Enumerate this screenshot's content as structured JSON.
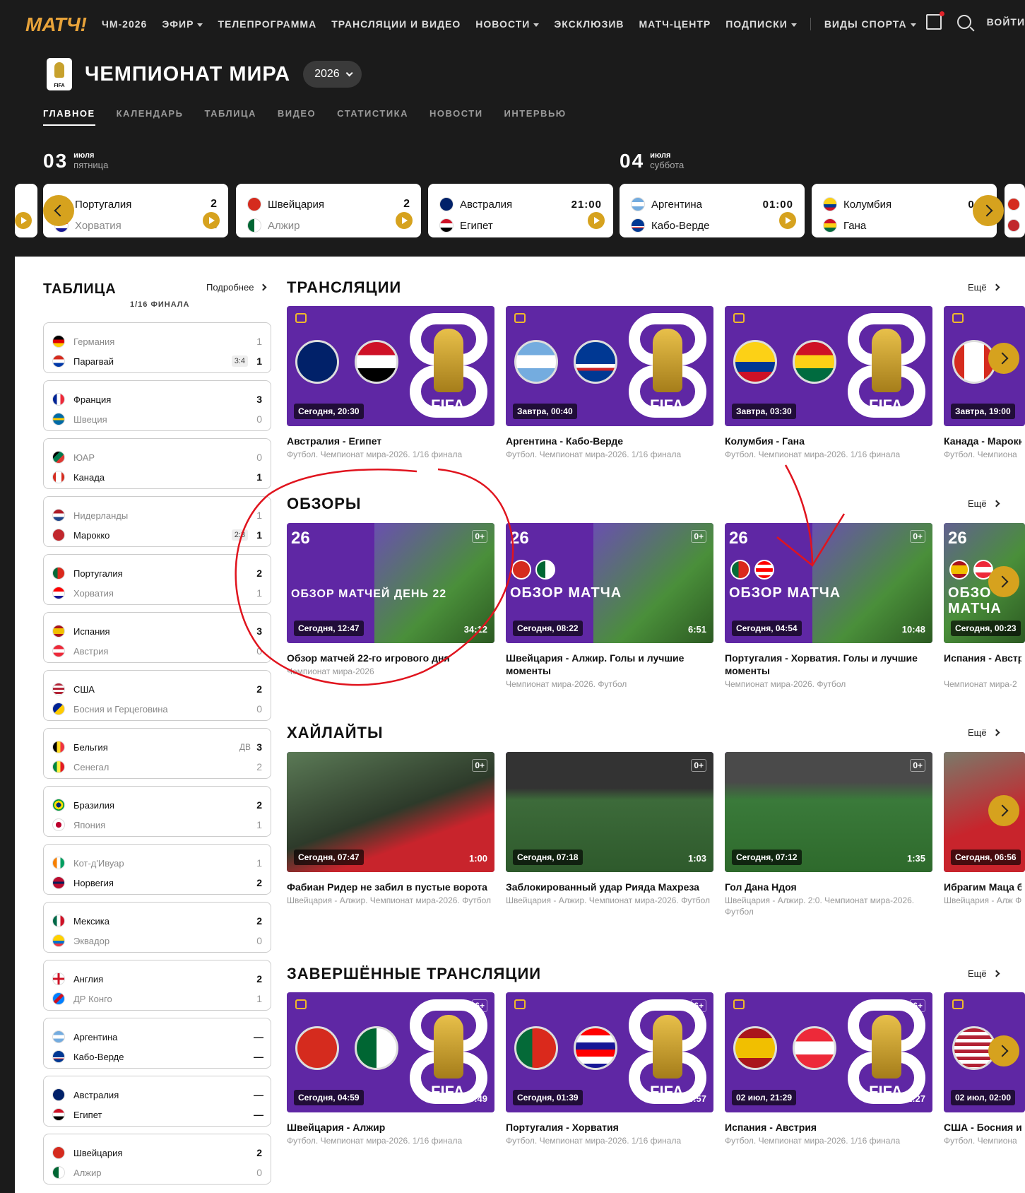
{
  "nav": {
    "items": [
      "ЧМ-2026",
      "ЭФИР",
      "ТЕЛЕПРОГРАММА",
      "ТРАНСЛЯЦИИ И ВИДЕО",
      "НОВОСТИ",
      "ЭКСКЛЮЗИВ",
      "МАТЧ-ЦЕНТР",
      "ПОДПИСКИ",
      "ВИДЫ СПОРТА"
    ],
    "login": "ВОЙТИ",
    "logo": "МАТЧ!"
  },
  "champ": {
    "title": "ЧЕМПИОНАТ МИРА",
    "year": "2026",
    "logo_text": "FIFA"
  },
  "subnav": [
    "ГЛАВНОЕ",
    "КАЛЕНДАРЬ",
    "ТАБЛИЦА",
    "ВИДЕО",
    "СТАТИСТИКА",
    "НОВОСТИ",
    "ИНТЕРВЬЮ"
  ],
  "days": [
    {
      "num": "03",
      "month": "июля",
      "weekday": "пятница"
    },
    {
      "num": "04",
      "month": "июля",
      "weekday": "суббота"
    }
  ],
  "matches": [
    {
      "t1": "Португалия",
      "t2": "Хорватия",
      "s1": "2",
      "s2": "1"
    },
    {
      "t1": "Швейцария",
      "t2": "Алжир",
      "s1": "2",
      "s2": "0"
    },
    {
      "t1": "Австралия",
      "t2": "Египет",
      "time": "21:00"
    },
    {
      "t1": "Аргентина",
      "t2": "Кабо-Верде",
      "time": "01:00"
    },
    {
      "t1": "Колумбия",
      "t2": "Гана",
      "time": "04:"
    }
  ],
  "table": {
    "title": "ТАБЛИЦА",
    "more": "Подробнее",
    "stage": "1/16 ФИНАЛА",
    "rows": [
      {
        "t1": "Германия",
        "t2": "Парагвай",
        "s1": "1",
        "s2": "1",
        "pen": "3:4",
        "w": 2
      },
      {
        "t1": "Франция",
        "t2": "Швеция",
        "s1": "3",
        "s2": "0",
        "w": 1
      },
      {
        "t1": "ЮАР",
        "t2": "Канада",
        "s1": "0",
        "s2": "1",
        "w": 2
      },
      {
        "t1": "Нидерланды",
        "t2": "Марокко",
        "s1": "1",
        "s2": "1",
        "pen": "2:3",
        "w": 2
      },
      {
        "t1": "Португалия",
        "t2": "Хорватия",
        "s1": "2",
        "s2": "1",
        "w": 1
      },
      {
        "t1": "Испания",
        "t2": "Австрия",
        "s1": "3",
        "s2": "0",
        "w": 1
      },
      {
        "t1": "США",
        "t2": "Босния и Герцеговина",
        "s1": "2",
        "s2": "0",
        "w": 1
      },
      {
        "t1": "Бельгия",
        "t2": "Сенегал",
        "s1": "3",
        "s2": "2",
        "et": "ДВ",
        "w": 1
      },
      {
        "t1": "Бразилия",
        "t2": "Япония",
        "s1": "2",
        "s2": "1",
        "w": 1
      },
      {
        "t1": "Кот-д'Ивуар",
        "t2": "Норвегия",
        "s1": "1",
        "s2": "2",
        "w": 2
      },
      {
        "t1": "Мексика",
        "t2": "Эквадор",
        "s1": "2",
        "s2": "0",
        "w": 1
      },
      {
        "t1": "Англия",
        "t2": "ДР Конго",
        "s1": "2",
        "s2": "1",
        "w": 1
      },
      {
        "t1": "Аргентина",
        "t2": "Кабо-Верде",
        "s1": "—",
        "s2": "—",
        "w": 0
      },
      {
        "t1": "Австралия",
        "t2": "Египет",
        "s1": "—",
        "s2": "—",
        "w": 0
      },
      {
        "t1": "Швейцария",
        "t2": "Алжир",
        "s1": "2",
        "s2": "0",
        "w": 1
      }
    ]
  },
  "sections": {
    "more": "Ещё",
    "broadcasts": "ТРАНСЛЯЦИИ",
    "reviews": "ОБЗОРЫ",
    "highlights": "ХАЙЛАЙТЫ",
    "finished": "ЗАВЕРШЁННЫЕ ТРАНСЛЯЦИИ"
  },
  "broadcasts": [
    {
      "badge": "Сегодня, 20:30",
      "title": "Австралия - Египет",
      "sub": "Футбол. Чемпионат мира-2026. 1/16 финала"
    },
    {
      "badge": "Завтра, 00:40",
      "title": "Аргентина - Кабо-Верде",
      "sub": "Футбол. Чемпионат мира-2026. 1/16 финала"
    },
    {
      "badge": "Завтра, 03:30",
      "title": "Колумбия - Гана",
      "sub": "Футбол. Чемпионат мира-2026. 1/16 финала"
    },
    {
      "badge": "Завтра, 19:00",
      "title": "Канада - Марокк",
      "sub": "Футбол. Чемпиона"
    }
  ],
  "reviews": [
    {
      "badge": "Сегодня, 12:47",
      "dur": "34:12",
      "age": "0+",
      "overlay": "ОБЗОР МАТЧЕЙ ДЕНЬ 22",
      "title": "Обзор матчей 22-го игрового дня",
      "sub": "Чемпионат мира-2026"
    },
    {
      "badge": "Сегодня, 08:22",
      "dur": "6:51",
      "age": "0+",
      "overlay": "ОБЗОР МАТЧА",
      "title": "Швейцария - Алжир. Голы и лучшие моменты",
      "sub": "Чемпионат мира-2026. Футбол"
    },
    {
      "badge": "Сегодня, 04:54",
      "dur": "10:48",
      "age": "0+",
      "overlay": "ОБЗОР МАТЧА",
      "title": "Португалия - Хорватия. Голы и лучшие моменты",
      "sub": "Чемпионат мира-2026. Футбол"
    },
    {
      "badge": "Сегодня, 00:23",
      "dur": "",
      "age": "",
      "overlay": "ОБЗО МАТЧА",
      "title": "Испания - Австр моменты",
      "sub": "Чемпионат мира-2"
    }
  ],
  "highlights": [
    {
      "badge": "Сегодня, 07:47",
      "dur": "1:00",
      "age": "0+",
      "title": "Фабиан Ридер не забил в пустые ворота",
      "sub": "Швейцария - Алжир. Чемпионат мира-2026. Футбол"
    },
    {
      "badge": "Сегодня, 07:18",
      "dur": "1:03",
      "age": "0+",
      "title": "Заблокированный удар Рияда Махреза",
      "sub": "Швейцария - Алжир. Чемпионат мира-2026. Футбол"
    },
    {
      "badge": "Сегодня, 07:12",
      "dur": "1:35",
      "age": "0+",
      "title": "Гол Дана Ндоя",
      "sub": "Швейцария - Алжир. 2:0. Чемпионат мира-2026. Футбол"
    },
    {
      "badge": "Сегодня, 06:56",
      "dur": "",
      "age": "",
      "title": "Ибрагим Маца б",
      "sub": "Швейцария - Алж Футбол"
    }
  ],
  "finished": [
    {
      "badge": "Сегодня, 04:59",
      "dur": "2:58:49",
      "age": "6+",
      "title": "Швейцария - Алжир",
      "sub": "Футбол. Чемпионат мира-2026. 1/16 финала"
    },
    {
      "badge": "Сегодня, 01:39",
      "dur": "2:34:57",
      "age": "6+",
      "title": "Португалия - Хорватия",
      "sub": "Футбол. Чемпионат мира-2026. 1/16 финала"
    },
    {
      "badge": "02 июл, 21:29",
      "dur": "2:31:27",
      "age": "6+",
      "title": "Испания - Австрия",
      "sub": "Футбол. Чемпионат мира-2026. 1/16 финала"
    },
    {
      "badge": "02 июл, 02:00",
      "dur": "",
      "age": "",
      "title": "США - Босния и",
      "sub": "Футбол. Чемпиона"
    }
  ],
  "colors": {
    "accent": "#d6a21e",
    "purple": "#5f27a4",
    "dark": "#1b1b1b",
    "annotation": "#e0141e"
  }
}
